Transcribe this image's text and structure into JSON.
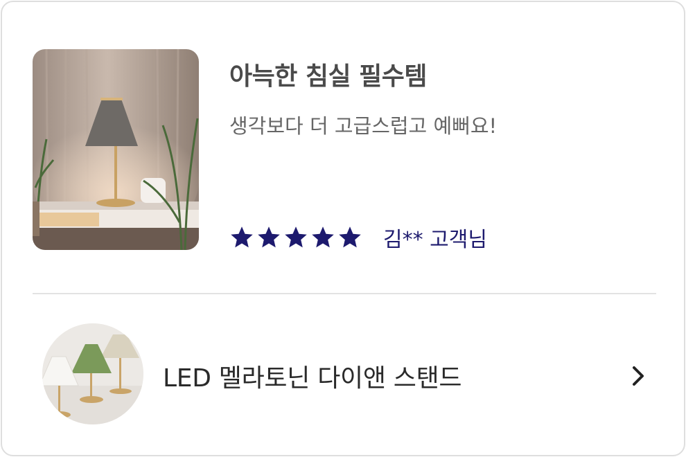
{
  "review": {
    "title": "아늑한 침실 필수템",
    "text": "생각보다 더 고급스럽고 예뻐요!",
    "rating": 5,
    "rating_max": 5,
    "reviewer": "김** 고객님",
    "photo_icon": "review-photo-lamp",
    "star_color": "#1d1a6e"
  },
  "product": {
    "name": "LED 멜라토닌 다이앤 스탠드",
    "thumb_icon": "product-thumb-lamps",
    "chevron_icon": "chevron-right-icon"
  }
}
